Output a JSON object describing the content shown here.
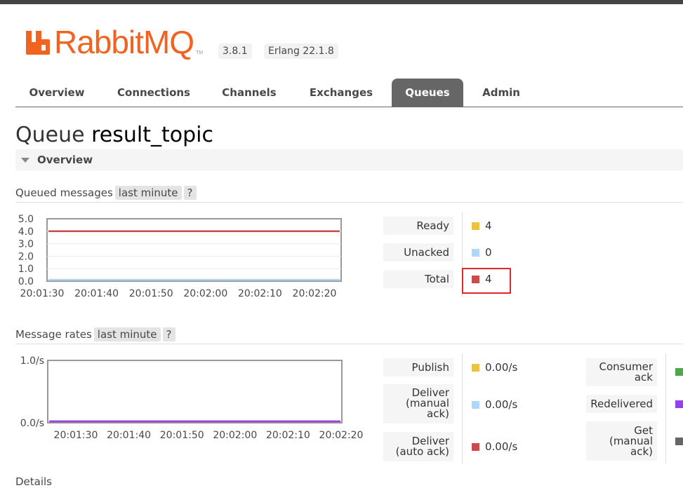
{
  "header": {
    "logo_text": "RabbitMQ",
    "logo_tm": "TM",
    "version": "3.8.1",
    "erlang": "Erlang 22.1.8"
  },
  "tabs": [
    {
      "label": "Overview",
      "active": false
    },
    {
      "label": "Connections",
      "active": false
    },
    {
      "label": "Channels",
      "active": false
    },
    {
      "label": "Exchanges",
      "active": false
    },
    {
      "label": "Queues",
      "active": true
    },
    {
      "label": "Admin",
      "active": false
    }
  ],
  "page": {
    "title_prefix": "Queue",
    "queue_name": "result_topic"
  },
  "overview_section": {
    "label": "Overview"
  },
  "queued_messages": {
    "label": "Queued messages",
    "range": "last minute",
    "help": "?",
    "stats": [
      {
        "label": "Ready",
        "value": "4",
        "color": "#edc240"
      },
      {
        "label": "Unacked",
        "value": "0",
        "color": "#afd8f8"
      },
      {
        "label": "Total",
        "value": "4",
        "color": "#cb4b4b"
      }
    ]
  },
  "message_rates": {
    "label": "Message rates",
    "range": "last minute",
    "help": "?",
    "left_stats": [
      {
        "label": "Publish",
        "value": "0.00/s",
        "color": "#edc240"
      },
      {
        "label": "Deliver\n(manual\nack)",
        "value": "0.00/s",
        "color": "#afd8f8"
      },
      {
        "label": "Deliver\n(auto ack)",
        "value": "0.00/s",
        "color": "#cb4b4b"
      }
    ],
    "right_stats": [
      {
        "label": "Consumer\nack",
        "color": "#4da74d"
      },
      {
        "label": "Redelivered",
        "color": "#9440ed"
      },
      {
        "label": "Get\n(manual\nack)",
        "color": "#666666"
      }
    ]
  },
  "chart_data": [
    {
      "type": "line",
      "title": "Queued messages",
      "x": [
        "20:01:30",
        "20:01:40",
        "20:01:50",
        "20:02:00",
        "20:02:10",
        "20:02:20"
      ],
      "yticks": [
        "5.0",
        "4.0",
        "3.0",
        "2.0",
        "1.0",
        "0.0"
      ],
      "ylim": [
        0,
        5
      ],
      "grid": true,
      "series": [
        {
          "name": "Ready",
          "color": "#edc240",
          "values": [
            4,
            4,
            4,
            4,
            4,
            4
          ]
        },
        {
          "name": "Unacked",
          "color": "#afd8f8",
          "values": [
            0,
            0,
            0,
            0,
            0,
            0
          ]
        },
        {
          "name": "Total",
          "color": "#cb4b4b",
          "values": [
            4,
            4,
            4,
            4,
            4,
            4
          ]
        }
      ]
    },
    {
      "type": "line",
      "title": "Message rates",
      "x": [
        "20:01:30",
        "20:01:40",
        "20:01:50",
        "20:02:00",
        "20:02:10",
        "20:02:20"
      ],
      "yticks": [
        "1.0/s",
        "0.0/s"
      ],
      "ylim": [
        0,
        1
      ],
      "grid": false,
      "series": [
        {
          "name": "Publish",
          "color": "#edc240",
          "values": [
            0,
            0,
            0,
            0,
            0,
            0
          ]
        },
        {
          "name": "Deliver (manual ack)",
          "color": "#afd8f8",
          "values": [
            0,
            0,
            0,
            0,
            0,
            0
          ]
        },
        {
          "name": "Deliver (auto ack)",
          "color": "#cb4b4b",
          "values": [
            0,
            0,
            0,
            0,
            0,
            0
          ]
        },
        {
          "name": "Redelivered",
          "color": "#9440ed",
          "values": [
            0,
            0,
            0,
            0,
            0,
            0
          ]
        }
      ]
    }
  ],
  "footer": {
    "details_label": "Details"
  }
}
